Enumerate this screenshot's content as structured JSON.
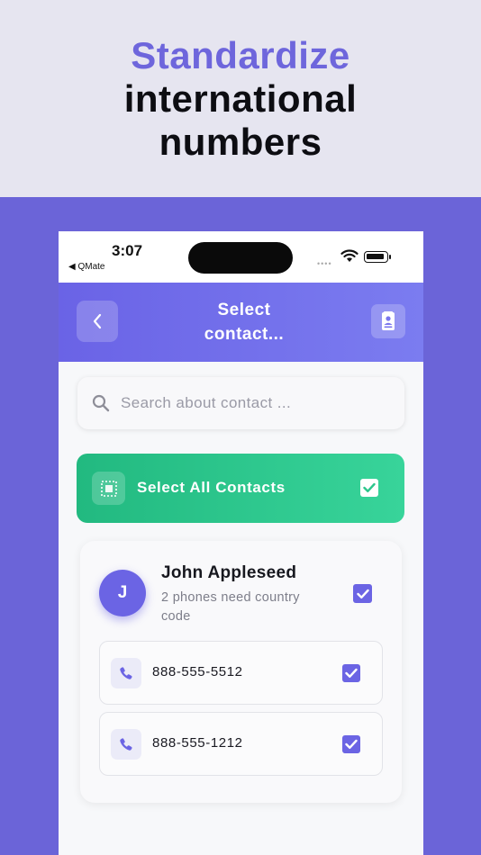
{
  "hero": {
    "line1": "Standardize",
    "line2": "international",
    "line3": "numbers"
  },
  "status_bar": {
    "time": "3:07",
    "back_app": "◀ QMate"
  },
  "navbar": {
    "title": "Select contact..."
  },
  "search": {
    "placeholder": "Search about contact ..."
  },
  "select_all": {
    "label": "Select All Contacts",
    "checked": true
  },
  "contact": {
    "initial": "J",
    "name": "John Appleseed",
    "subtitle": "2 phones need country code",
    "checked": true,
    "phones": [
      {
        "number": "888-555-5512",
        "checked": true
      },
      {
        "number": "888-555-1212",
        "checked": true
      }
    ]
  },
  "colors": {
    "accent": "#6b64e4",
    "success": "#2cc68c",
    "hero_highlight": "#6e66dc",
    "background": "#6b64d8"
  },
  "icons": [
    "chevron-left-icon",
    "contacts-book-icon",
    "search-icon",
    "select-all-icon",
    "checkmark-icon",
    "phone-icon",
    "wifi-icon",
    "battery-icon"
  ]
}
